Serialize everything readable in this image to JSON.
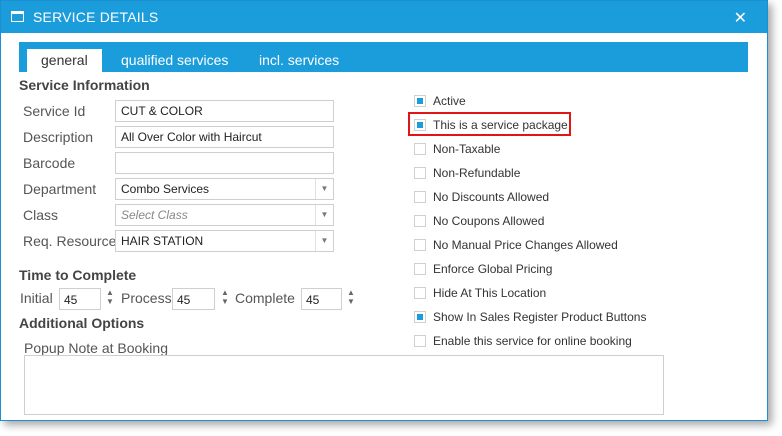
{
  "window": {
    "title": "SERVICE DETAILS",
    "close_glyph": "✕",
    "accent_color": "#1b9ddb"
  },
  "tabs": [
    {
      "label": "general",
      "active": true
    },
    {
      "label": "qualified services",
      "active": false
    },
    {
      "label": "incl. services",
      "active": false
    }
  ],
  "service_info": {
    "heading": "Service Information",
    "service_id": {
      "label": "Service Id",
      "value": "CUT & COLOR"
    },
    "description": {
      "label": "Description",
      "value": "All Over Color with Haircut"
    },
    "barcode": {
      "label": "Barcode",
      "value": ""
    },
    "department": {
      "label": "Department",
      "value": "Combo Services"
    },
    "class": {
      "label": "Class",
      "placeholder": "Select Class"
    },
    "req_resource": {
      "label": "Req. Resource",
      "value": "HAIR STATION"
    }
  },
  "time_to_complete": {
    "heading": "Time to Complete",
    "initial": {
      "label": "Initial",
      "value": "45"
    },
    "process": {
      "label": "Process",
      "value": "45"
    },
    "complete": {
      "label": "Complete",
      "value": "45"
    }
  },
  "additional_options": {
    "heading": "Additional Options",
    "popup_note_label": "Popup Note at Booking",
    "popup_note_value": ""
  },
  "options": [
    {
      "label": "Active",
      "checked": true
    },
    {
      "label": "This is a service package",
      "checked": true,
      "highlighted": true
    },
    {
      "label": "Non-Taxable",
      "checked": false
    },
    {
      "label": "Non-Refundable",
      "checked": false
    },
    {
      "label": "No Discounts Allowed",
      "checked": false
    },
    {
      "label": "No Coupons Allowed",
      "checked": false
    },
    {
      "label": "No Manual Price Changes Allowed",
      "checked": false
    },
    {
      "label": "Enforce Global Pricing",
      "checked": false
    },
    {
      "label": "Hide At This Location",
      "checked": false
    },
    {
      "label": "Show In Sales Register Product Buttons",
      "checked": true
    },
    {
      "label": "Enable this service for online booking",
      "checked": false
    }
  ],
  "highlight_color": "#e01515"
}
